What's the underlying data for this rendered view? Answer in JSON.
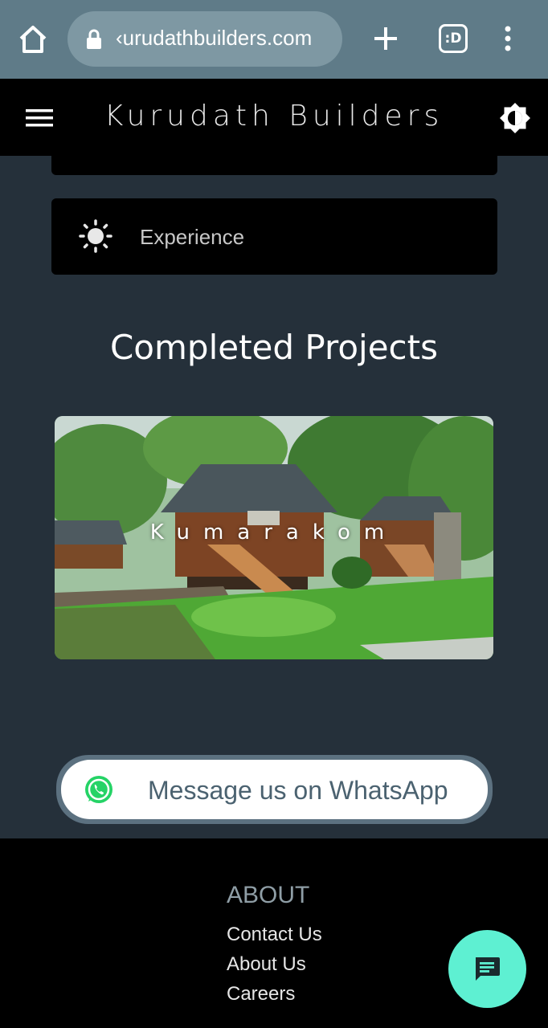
{
  "browser": {
    "url": "‹urudathbuilders.com",
    "tabs_count": ":D"
  },
  "header": {
    "title": "Kurudath Builders"
  },
  "cards": {
    "experience_label": "Experience"
  },
  "projects": {
    "section_title": "Completed Projects",
    "items": [
      {
        "label": "Kumarakom"
      }
    ]
  },
  "whatsapp": {
    "label": "Message us on WhatsApp",
    "color": "#25d366"
  },
  "footer": {
    "heading": "ABOUT",
    "links": [
      "Contact Us",
      "About Us",
      "Careers"
    ]
  },
  "colors": {
    "page_bg": "#25303a",
    "chrome_bg": "#5f7b88",
    "fab_bg": "#5ef0d2"
  }
}
